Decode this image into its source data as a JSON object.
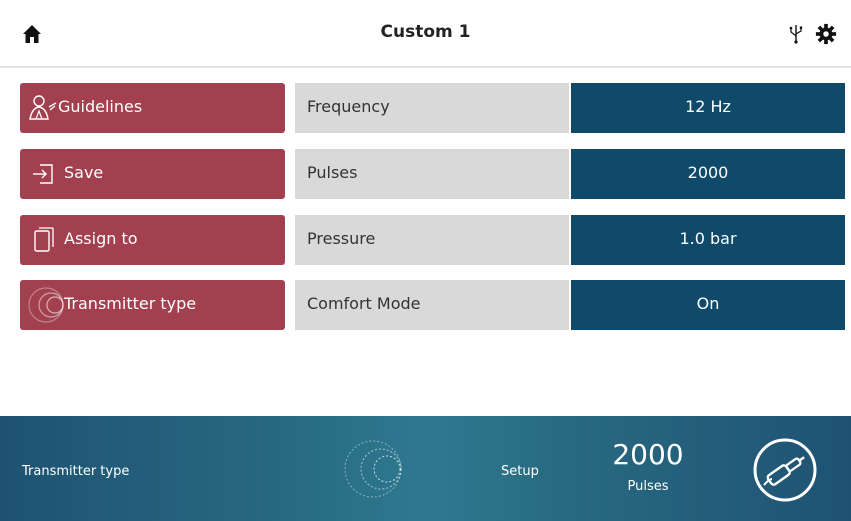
{
  "header": {
    "title": "Custom 1",
    "icons": [
      "home-icon",
      "usb-icon",
      "gear-icon"
    ]
  },
  "actions": [
    {
      "label": "Guidelines",
      "icon": "guidelines-icon"
    },
    {
      "label": "Save",
      "icon": "save-icon"
    },
    {
      "label": "Assign to",
      "icon": "assign-icon"
    },
    {
      "label": "Transmitter type",
      "icon": "transmitter-icon"
    }
  ],
  "params": [
    {
      "label": "Frequency",
      "value": "12 Hz"
    },
    {
      "label": "Pulses",
      "value": "2000"
    },
    {
      "label": "Pressure",
      "value": "1.0 bar"
    },
    {
      "label": "Comfort Mode",
      "value": "On"
    }
  ],
  "footer": {
    "transmitter_label": "Transmitter type",
    "setup_label": "Setup",
    "pulses_count": "2000",
    "pulses_unit": "Pulses"
  },
  "colors": {
    "action_button": "#a3404f",
    "param_label_bg": "#d9d9d9",
    "param_value_bg": "#0f4a6a",
    "footer_bg": "#286b82"
  }
}
